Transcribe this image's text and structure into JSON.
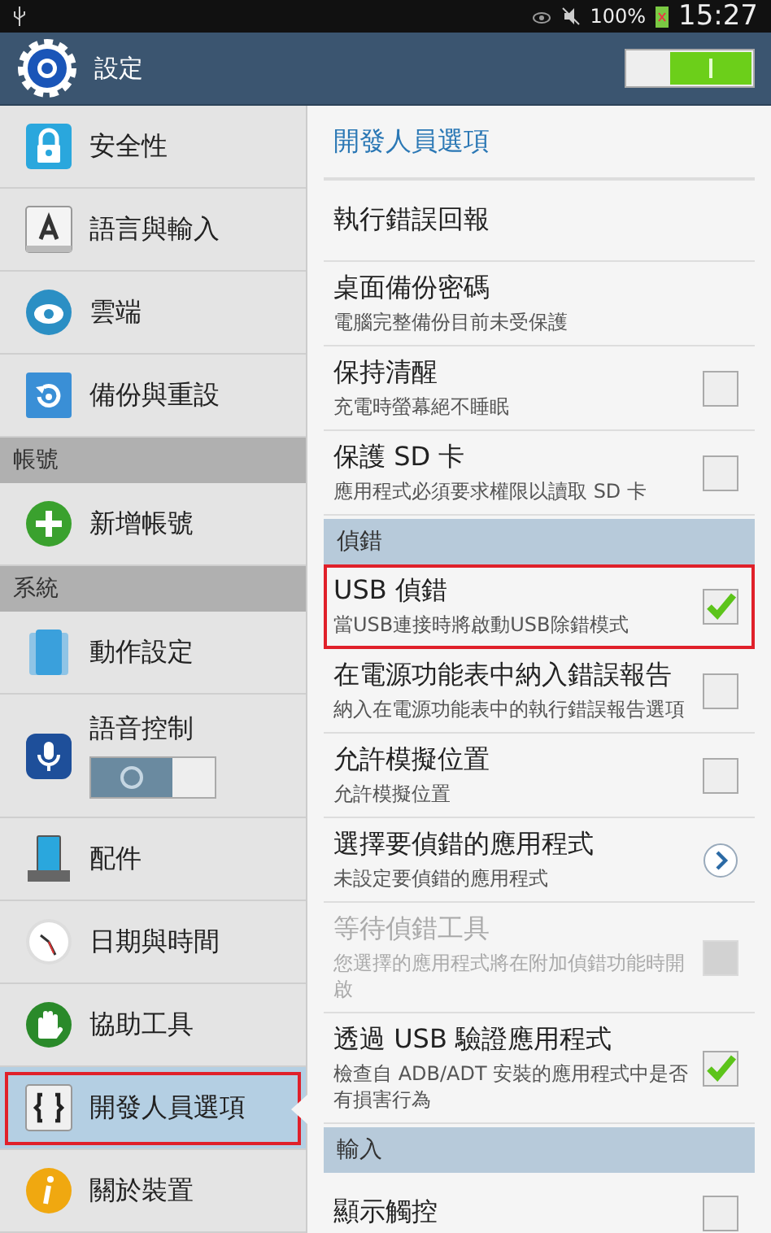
{
  "status_bar": {
    "battery": "100%",
    "time": "15:27"
  },
  "header": {
    "title": "設定",
    "master_switch": {
      "on": true
    }
  },
  "sidebar": {
    "items": [
      {
        "kind": "item",
        "label": "安全性",
        "selected": false
      },
      {
        "kind": "item",
        "label": "語言與輸入",
        "selected": false
      },
      {
        "kind": "item",
        "label": "雲端",
        "selected": false
      },
      {
        "kind": "item",
        "label": "備份與重設",
        "selected": false
      },
      {
        "kind": "header",
        "label": "帳號"
      },
      {
        "kind": "item",
        "label": "新增帳號",
        "selected": false
      },
      {
        "kind": "header",
        "label": "系統"
      },
      {
        "kind": "item",
        "label": "動作設定",
        "selected": false
      },
      {
        "kind": "toggle",
        "label": "語音控制",
        "selected": false,
        "on": false
      },
      {
        "kind": "item",
        "label": "配件",
        "selected": false
      },
      {
        "kind": "item",
        "label": "日期與時間",
        "selected": false
      },
      {
        "kind": "item",
        "label": "協助工具",
        "selected": false
      },
      {
        "kind": "item",
        "label": "開發人員選項",
        "selected": true,
        "highlighted": true
      },
      {
        "kind": "item",
        "label": "關於裝置",
        "selected": false
      }
    ]
  },
  "detail": {
    "title": "開發人員選項",
    "rows": [
      {
        "kind": "plain",
        "title": "執行錯誤回報"
      },
      {
        "kind": "plain",
        "title": "桌面備份密碼",
        "subtitle": "電腦完整備份目前未受保護"
      },
      {
        "kind": "checkbox",
        "title": "保持清醒",
        "subtitle": "充電時螢幕絕不睡眠",
        "checked": false,
        "disabled": false
      },
      {
        "kind": "checkbox",
        "title": "保護 SD 卡",
        "subtitle": "應用程式必須要求權限以讀取 SD 卡",
        "checked": false,
        "disabled": false
      },
      {
        "kind": "header",
        "title": "偵錯"
      },
      {
        "kind": "checkbox",
        "title": "USB 偵錯",
        "subtitle": "當USB連接時將啟動USB除錯模式",
        "checked": true,
        "disabled": false,
        "highlighted": true
      },
      {
        "kind": "checkbox",
        "title": "在電源功能表中納入錯誤報告",
        "subtitle": "納入在電源功能表中的執行錯誤報告選項",
        "checked": false,
        "disabled": false
      },
      {
        "kind": "checkbox",
        "title": "允許模擬位置",
        "subtitle": "允許模擬位置",
        "checked": false,
        "disabled": false
      },
      {
        "kind": "link",
        "title": "選擇要偵錯的應用程式",
        "subtitle": "未設定要偵錯的應用程式"
      },
      {
        "kind": "checkbox",
        "title": "等待偵錯工具",
        "subtitle": "您選擇的應用程式將在附加偵錯功能時開啟",
        "checked": false,
        "disabled": true
      },
      {
        "kind": "checkbox",
        "title": "透過 USB 驗證應用程式",
        "subtitle": "檢查自 ADB/ADT 安裝的應用程式中是否有損害行為",
        "checked": true,
        "disabled": false
      },
      {
        "kind": "header",
        "title": "輸入"
      },
      {
        "kind": "checkbox",
        "title": "顯示觸控",
        "checked": false,
        "disabled": false
      }
    ]
  }
}
